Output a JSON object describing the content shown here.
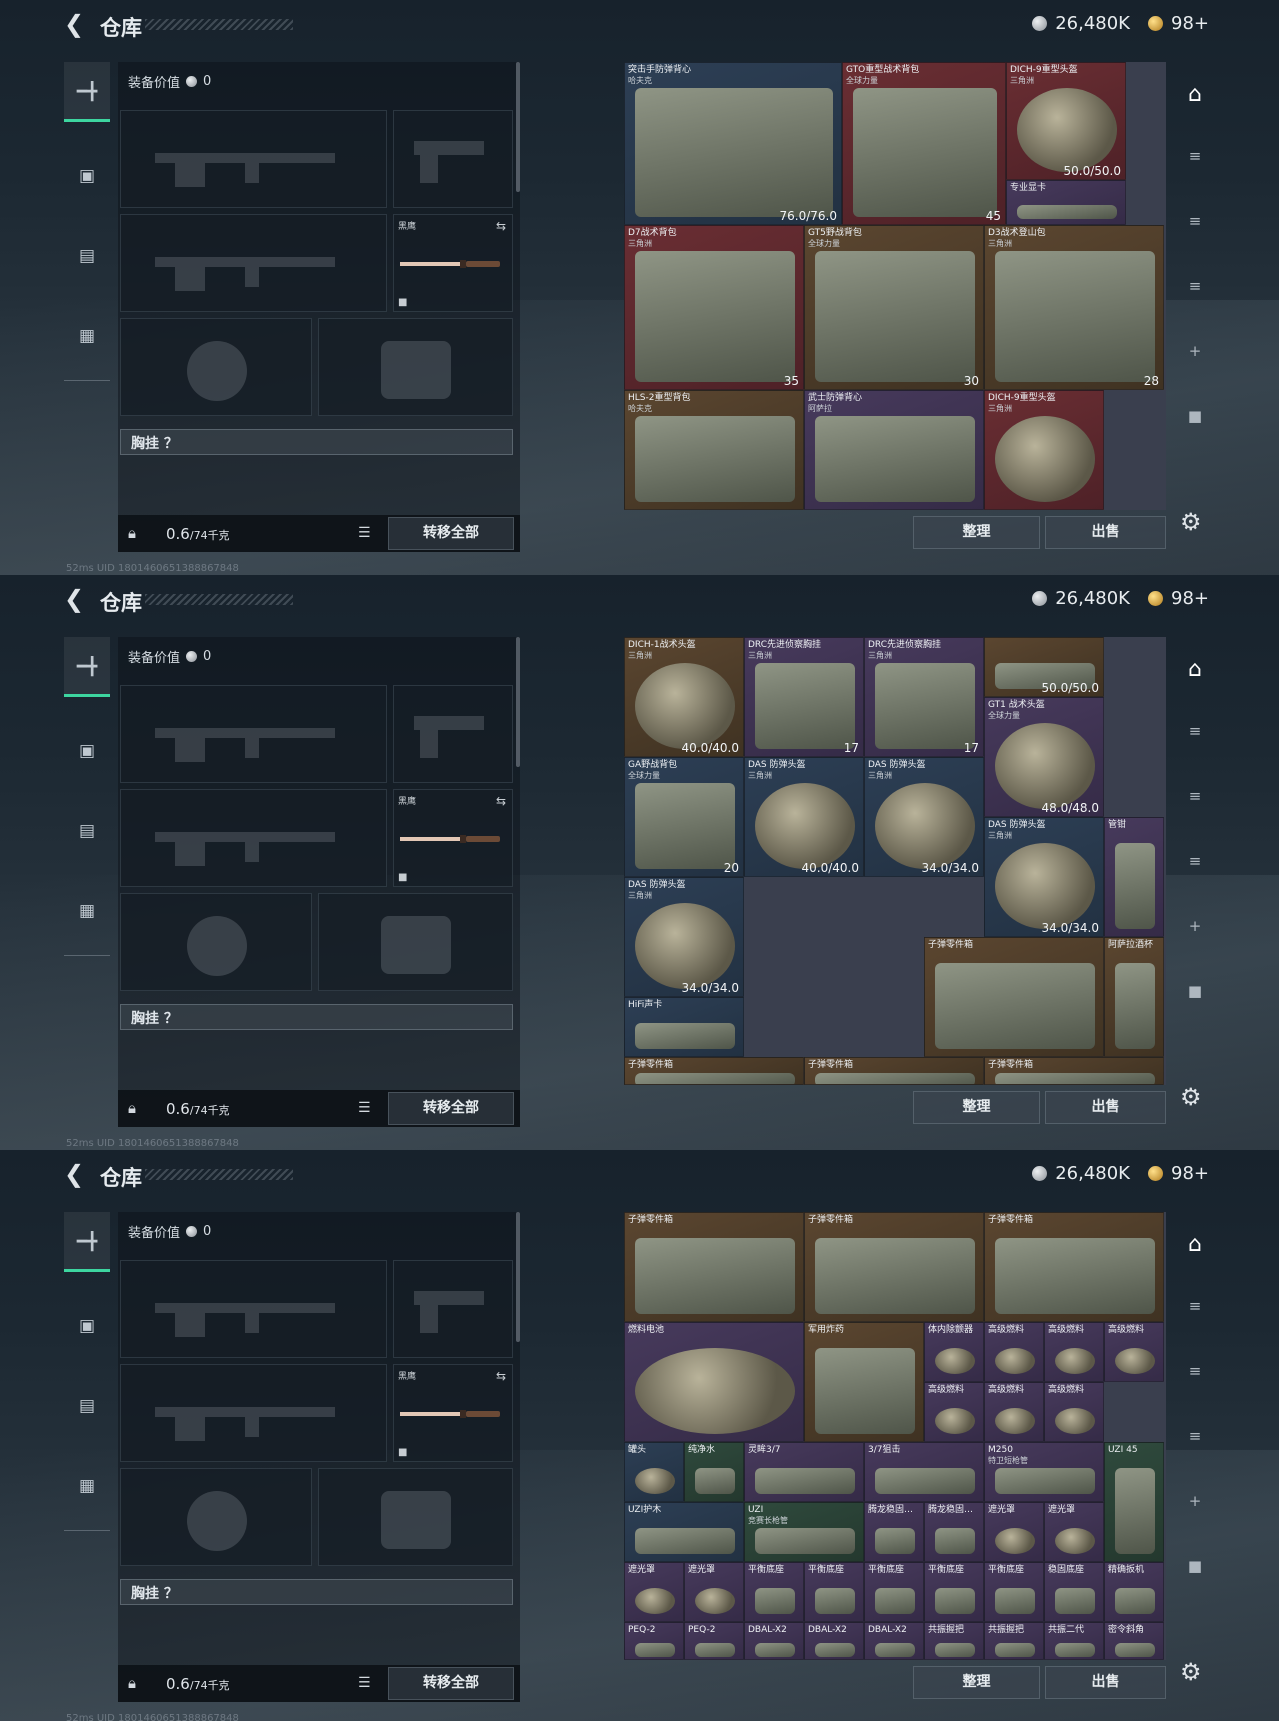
{
  "panels": [
    {
      "id": "p1"
    },
    {
      "id": "p2"
    },
    {
      "id": "p3"
    }
  ],
  "header": {
    "back_icon": "back-arrow-icon",
    "title": "仓库",
    "silver": "26,480K",
    "gold": "98+"
  },
  "left_nav": {
    "items": [
      {
        "name": "weapons-tab",
        "icon": "pistol-icon",
        "active": true
      },
      {
        "name": "armor-tab",
        "icon": "vest-icon"
      },
      {
        "name": "backpack-tab",
        "icon": "backpack-icon"
      },
      {
        "name": "case-tab",
        "icon": "briefcase-icon"
      }
    ]
  },
  "equipment": {
    "value_label": "装备价值",
    "value": "0",
    "melee_label": "黑鹰",
    "chest_rig_label": "胸挂 ？",
    "weight": "0.6",
    "weight_unit": "/74千克",
    "transfer_all": "转移全部"
  },
  "actions": {
    "sort": "整理",
    "sell": "出售"
  },
  "status_text": "52ms  UID 1801460651388867848",
  "inventory_p1": [
    {
      "name": "突击手防弹背心",
      "sub": "哈夫克",
      "val": "76.0/76.0",
      "color": "blue"
    },
    {
      "name": "GTO重型战术背包",
      "sub": "全球力量",
      "val": "45",
      "color": "red"
    },
    {
      "name": "DICH-9重型头盔",
      "sub": "三角洲",
      "val": "50.0/50.0",
      "color": "red"
    },
    {
      "name": "专业显卡",
      "sub": "",
      "val": "",
      "color": "purple"
    },
    {
      "name": "D7战术背包",
      "sub": "三角洲",
      "val": "35",
      "color": "red"
    },
    {
      "name": "GT5野战背包",
      "sub": "全球力量",
      "val": "30",
      "color": "gold"
    },
    {
      "name": "D3战术登山包",
      "sub": "三角洲",
      "val": "28",
      "color": "gold"
    },
    {
      "name": "HLS-2重型背包",
      "sub": "哈夫克",
      "val": "",
      "color": "gold"
    },
    {
      "name": "武士防弹背心",
      "sub": "阿萨拉",
      "val": "",
      "color": "purple"
    },
    {
      "name": "DICH-9重型头盔",
      "sub": "三角洲",
      "val": "",
      "color": "red"
    }
  ],
  "inventory_p2": [
    {
      "name": "DICH-1战术头盔",
      "sub": "三角洲",
      "val": "40.0/40.0",
      "color": "gold"
    },
    {
      "name": "DRC先进侦察胸挂",
      "sub": "三角洲",
      "val": "17",
      "color": "purple"
    },
    {
      "name": "DRC先进侦察胸挂",
      "sub": "三角洲",
      "val": "17",
      "color": "purple"
    },
    {
      "name": "",
      "sub": "",
      "val": "50.0/50.0",
      "color": "gold"
    },
    {
      "name": "GT1 战术头盔",
      "sub": "全球力量",
      "val": "48.0/48.0",
      "color": "purple"
    },
    {
      "name": "GA野战背包",
      "sub": "全球力量",
      "val": "20",
      "color": "blue"
    },
    {
      "name": "DAS 防弹头盔",
      "sub": "三角洲",
      "val": "40.0/40.0",
      "color": "blue"
    },
    {
      "name": "DAS 防弹头盔",
      "sub": "三角洲",
      "val": "34.0/34.0",
      "color": "blue"
    },
    {
      "name": "DAS 防弹头盔",
      "sub": "三角洲",
      "val": "34.0/34.0",
      "color": "blue"
    },
    {
      "name": "管钳",
      "sub": "",
      "val": "",
      "color": "purple"
    },
    {
      "name": "DAS 防弹头盔",
      "sub": "三角洲",
      "val": "34.0/34.0",
      "color": "blue"
    },
    {
      "name": "子弹零件箱",
      "sub": "",
      "val": "",
      "color": "gold"
    },
    {
      "name": "阿萨拉酒杯",
      "sub": "",
      "val": "",
      "color": "gold"
    },
    {
      "name": "HiFi声卡",
      "sub": "",
      "val": "",
      "color": "blue"
    },
    {
      "name": "子弹零件箱",
      "sub": "",
      "val": "",
      "color": "gold"
    },
    {
      "name": "子弹零件箱",
      "sub": "",
      "val": "",
      "color": "gold"
    },
    {
      "name": "子弹零件箱",
      "sub": "",
      "val": "",
      "color": "gold"
    }
  ],
  "inventory_p3": [
    {
      "name": "子弹零件箱",
      "val": "",
      "color": "gold"
    },
    {
      "name": "子弹零件箱",
      "val": "",
      "color": "gold"
    },
    {
      "name": "子弹零件箱",
      "val": "",
      "color": "gold"
    },
    {
      "name": "燃料电池",
      "val": "",
      "color": "purple"
    },
    {
      "name": "军用炸药",
      "val": "",
      "color": "gold"
    },
    {
      "name": "体内除颤器",
      "val": "",
      "color": "purple"
    },
    {
      "name": "高级燃料",
      "val": "",
      "color": "purple"
    },
    {
      "name": "高级燃料",
      "val": "",
      "color": "purple"
    },
    {
      "name": "高级燃料",
      "val": "",
      "color": "purple"
    },
    {
      "name": "高级燃料",
      "val": "",
      "color": "purple"
    },
    {
      "name": "高级燃料",
      "val": "",
      "color": "purple"
    },
    {
      "name": "高级燃料",
      "val": "",
      "color": "purple"
    },
    {
      "name": "罐头",
      "val": "",
      "color": "blue"
    },
    {
      "name": "纯净水",
      "val": "",
      "color": "green"
    },
    {
      "name": "灵眸3/7",
      "val": "",
      "color": "purple"
    },
    {
      "name": "3/7狙击",
      "val": "",
      "color": "purple"
    },
    {
      "name": "M250",
      "sub": "特卫短枪管",
      "val": "",
      "color": "purple"
    },
    {
      "name": "UZI 45",
      "val": "",
      "color": "green"
    },
    {
      "name": "UZI护木",
      "val": "",
      "color": "blue"
    },
    {
      "name": "UZI",
      "sub": "竞赛长枪管",
      "val": "",
      "color": "green"
    },
    {
      "name": "腾龙稳固…",
      "val": "",
      "color": "purple"
    },
    {
      "name": "腾龙稳固…",
      "val": "",
      "color": "purple"
    },
    {
      "name": "遮光罩",
      "val": "",
      "color": "purple"
    },
    {
      "name": "遮光罩",
      "val": "",
      "color": "purple"
    },
    {
      "name": "遮光罩",
      "val": "",
      "color": "purple"
    },
    {
      "name": "遮光罩",
      "val": "",
      "color": "purple"
    },
    {
      "name": "平衡底座",
      "val": "",
      "color": "purple"
    },
    {
      "name": "平衡底座",
      "val": "",
      "color": "purple"
    },
    {
      "name": "平衡底座",
      "val": "",
      "color": "purple"
    },
    {
      "name": "平衡底座",
      "val": "",
      "color": "purple"
    },
    {
      "name": "平衡底座",
      "val": "",
      "color": "purple"
    },
    {
      "name": "稳固底座",
      "val": "",
      "color": "purple"
    },
    {
      "name": "精确扳机",
      "val": "",
      "color": "purple"
    },
    {
      "name": "PEQ-2",
      "val": "",
      "color": "purple"
    },
    {
      "name": "PEQ-2",
      "val": "",
      "color": "purple"
    },
    {
      "name": "DBAL-X2",
      "val": "",
      "color": "purple"
    },
    {
      "name": "DBAL-X2",
      "val": "",
      "color": "purple"
    },
    {
      "name": "DBAL-X2",
      "val": "",
      "color": "purple"
    },
    {
      "name": "共振握把",
      "val": "",
      "color": "purple"
    },
    {
      "name": "共振握把",
      "val": "",
      "color": "purple"
    },
    {
      "name": "共振二代",
      "val": "",
      "color": "purple"
    },
    {
      "name": "密令斜角",
      "val": "",
      "color": "purple"
    }
  ]
}
